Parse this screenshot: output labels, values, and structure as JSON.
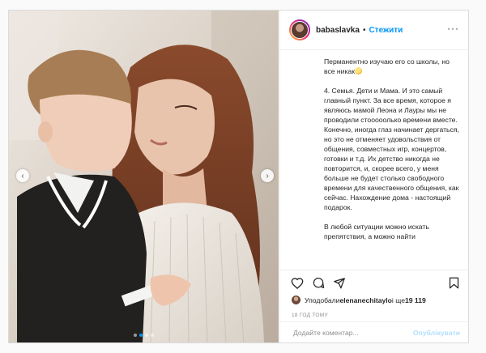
{
  "header": {
    "username": "babaslavka",
    "separator": "•",
    "follow_label": "Стежити",
    "more_label": "···"
  },
  "caption": {
    "paragraphs": [
      "Перманентно изучаю его со школы, но все никак",
      "4. Семья. Дети и Мама. И это самый главный пункт. За все время, которое я являюсь мамой Леона и Лауры мы не проводили стооооолько времени вместе. Конечно, иногда глаз начинает дергаться, но это не отменяет удовольствия от общения, совместных игр, концертов, готовки и т.д. Их детство никогда не повторится, и, скорее всего, у меня больше не будет столько свободного времени для качественного общения, как сейчас. Нахождение дома - настоящий подарок.",
      "В любой ситуации можно искать препятствия, а можно найти"
    ],
    "emoji_name": "grimacing-face-icon"
  },
  "likes": {
    "prefix": "Уподобали ",
    "liker": "elenanechitaylo",
    "suffix": " і ще ",
    "count": "19 119"
  },
  "timestamp": "18 год тому",
  "comment": {
    "placeholder": "Додайте коментар...",
    "post_label": "Опублікувати"
  },
  "carousel": {
    "slide_count": 4,
    "active_index": 1
  },
  "colors": {
    "accent": "#0095f6",
    "post_disabled": "#b2dffc"
  }
}
